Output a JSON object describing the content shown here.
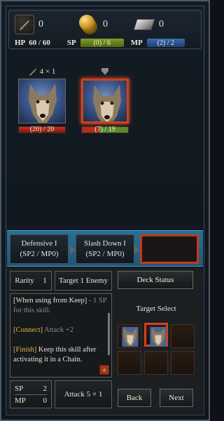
{
  "resources": {
    "weapon_count": "0",
    "gold": "0",
    "ingot": "0",
    "weapon_icon": "sword-icon",
    "gold_icon": "coin-stack-icon",
    "ingot_icon": "metal-ingot-icon"
  },
  "stats": {
    "hp_label": "HP",
    "hp_value": "60 / 60",
    "sp_label": "SP",
    "sp_value": "(0) / 6",
    "mp_label": "MP",
    "mp_value": "(2) / 2"
  },
  "enemies": [
    {
      "intent": "4 × 1",
      "intent_icon": "sword-icon",
      "hp": "(20) / 20",
      "hp_fraction": 1.0,
      "selected": false
    },
    {
      "intent": "",
      "intent_icon": "shield-icon",
      "hp": "(7) / 19",
      "hp_fraction": 0.37,
      "selected": true
    }
  ],
  "skills": [
    {
      "name": "Defensive I",
      "cost": "(SP2 / MP0)"
    },
    {
      "name": "Slash Down I",
      "cost": "(SP2 / MP0)"
    }
  ],
  "detail": {
    "rarity_label": "Rarity",
    "rarity_value": "1",
    "target_label": "Target 1 Enemy",
    "deck_status": "Deck Status",
    "target_select": "Target Select",
    "desc_line1": "[When using from Keep]",
    "desc_line1b": " - 1 SP for this skill.",
    "connect_tag": "[Connect]",
    "connect_text": " Attack +2",
    "finish_tag": "[Finish]",
    "finish_text": " Keep this skill after activating it in a Chain.",
    "sp_label": "SP",
    "sp_value": "2",
    "mp_label": "MP",
    "mp_value": "0",
    "attack_text": "Attack  5 × 1",
    "back": "Back",
    "next": "Next",
    "plus": "+"
  },
  "colors": {
    "selected_border": "#d1401d",
    "hp_red": "#b72b20",
    "hp_green": "#5a8a2a",
    "sp_green": "#6a8a1e",
    "mp_blue": "#2a5a9a",
    "strip_blue": "#2a6f95"
  }
}
